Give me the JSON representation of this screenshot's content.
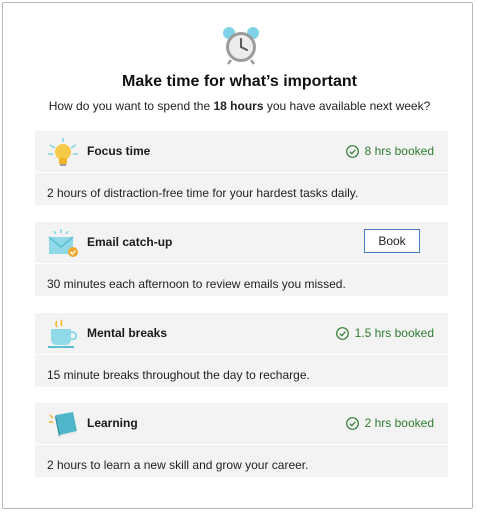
{
  "header": {
    "icon": "alarm-clock-icon",
    "title": "Make time for what’s important",
    "subtitle_before": "How do you want to spend the ",
    "subtitle_bold": "18 hours",
    "subtitle_after": " you have available next week?"
  },
  "colors": {
    "accent": "#4a7cc4",
    "booked": "#2e7d32",
    "card_bg": "#f3f3f3"
  },
  "cards": [
    {
      "icon": "lightbulb-icon",
      "title": "Focus time",
      "status": "8 hrs booked",
      "description": "2 hours of distraction-free time for your hardest tasks daily."
    },
    {
      "icon": "email-icon",
      "title": "Email catch-up",
      "button": "Book",
      "description": "30 minutes each afternoon to review emails you missed."
    },
    {
      "icon": "tea-cup-icon",
      "title": "Mental breaks",
      "status": "1.5 hrs booked",
      "description": "15 minute breaks throughout the day to recharge."
    },
    {
      "icon": "book-icon",
      "title": "Learning",
      "status": "2 hrs booked",
      "description": "2 hours to learn a new skill and grow your career."
    }
  ]
}
